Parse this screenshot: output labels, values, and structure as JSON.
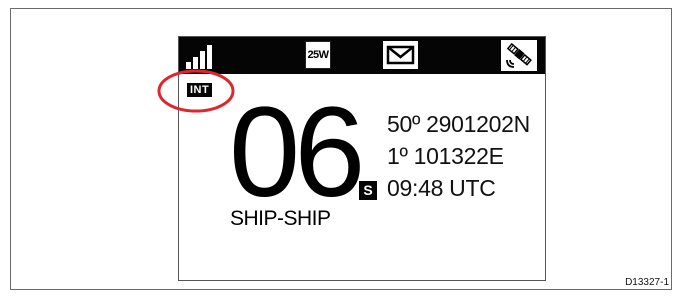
{
  "status_bar": {
    "signal_icon": "signal-bars-icon",
    "power_label": "25W",
    "message_icon": "envelope-icon",
    "gps_icon": "satellite-icon"
  },
  "int_badge": "INT",
  "channel": {
    "number": "06",
    "name": "SHIP-SHIP"
  },
  "position": {
    "latitude": "50º 2901202N",
    "longitude": "1º 101322E",
    "s_badge": "S",
    "time": "09:48 UTC"
  },
  "annotation_color": "#e0262c",
  "figure_id": "D13327-1"
}
